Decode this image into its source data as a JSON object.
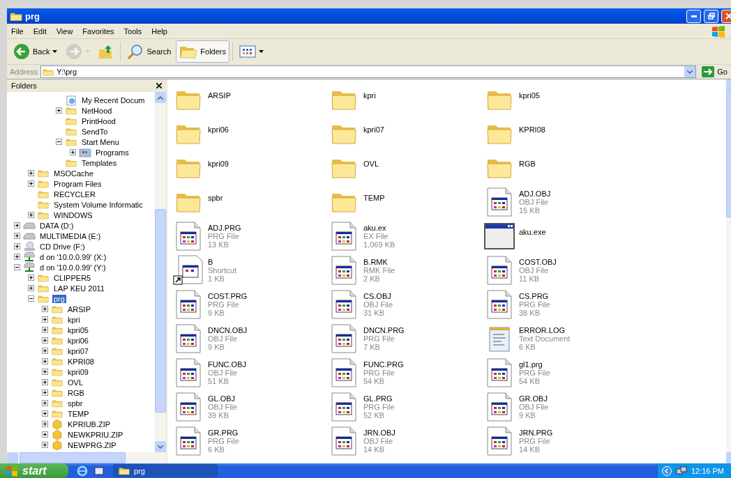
{
  "window": {
    "title": "prg"
  },
  "menu": [
    "File",
    "Edit",
    "View",
    "Favorites",
    "Tools",
    "Help"
  ],
  "toolbar": [
    {
      "kind": "back",
      "label": "Back",
      "caret": true,
      "disabled": false,
      "selected": false
    },
    {
      "kind": "forward",
      "caret": true,
      "disabled": true,
      "selected": false
    },
    {
      "kind": "up",
      "disabled": false,
      "selected": false
    },
    {
      "kind": "search",
      "label": "Search",
      "disabled": false,
      "selected": false
    },
    {
      "kind": "folders",
      "label": "Folders",
      "disabled": false,
      "selected": true
    },
    {
      "kind": "views",
      "caret": true,
      "disabled": false,
      "selected": false
    }
  ],
  "address": {
    "label": "Address",
    "value": "Y:\\prg",
    "go": "Go"
  },
  "folders_pane": {
    "title": "Folders",
    "tree": [
      {
        "children": [
          {
            "children": [
              {
                "children": [
                  {
                    "children": [
                      {
                        "label": "My Recent Docum",
                        "kind": "recent",
                        "selected": false
                      },
                      {
                        "label": "NetHood",
                        "kind": "folder",
                        "expanded": false,
                        "selected": false
                      },
                      {
                        "label": "PrintHood",
                        "kind": "folder",
                        "selected": false
                      },
                      {
                        "label": "SendTo",
                        "kind": "folder",
                        "selected": false
                      },
                      {
                        "label": "Start Menu",
                        "kind": "folder",
                        "expanded": true,
                        "selected": false,
                        "children": [
                          {
                            "label": "Programs",
                            "kind": "programs",
                            "expanded": false,
                            "selected": false
                          }
                        ]
                      },
                      {
                        "label": "Templates",
                        "kind": "folder",
                        "selected": false
                      }
                    ]
                  }
                ]
              },
              {
                "label": "MSOCache",
                "kind": "folder",
                "expanded": false,
                "selected": false
              },
              {
                "label": "Program Files",
                "kind": "folder",
                "expanded": false,
                "selected": false
              },
              {
                "label": "RECYCLER",
                "kind": "folder",
                "selected": false
              },
              {
                "label": "System Volume Informatic",
                "kind": "folder",
                "selected": false
              },
              {
                "label": "WINDOWS",
                "kind": "folder",
                "expanded": false,
                "selected": false
              }
            ]
          },
          {
            "label": "DATA (D:)",
            "kind": "drive",
            "expanded": false,
            "selected": false
          },
          {
            "label": "MULTIMEDIA (E:)",
            "kind": "drive",
            "expanded": false,
            "selected": false
          },
          {
            "label": "CD Drive (F:)",
            "kind": "cdrom",
            "expanded": false,
            "selected": false
          },
          {
            "label": "d on '10.0.0.99' (X:)",
            "kind": "network",
            "expanded": false,
            "selected": false
          },
          {
            "label": "d on '10.0.0.99' (Y:)",
            "kind": "network",
            "expanded": true,
            "selected": false,
            "children": [
              {
                "label": "CLIPPER5",
                "kind": "folder",
                "expanded": false,
                "selected": false
              },
              {
                "label": "LAP KEU 2011",
                "kind": "folder",
                "expanded": false,
                "selected": false
              },
              {
                "label": "prg",
                "kind": "folder",
                "expanded": true,
                "selected": true,
                "children": [
                  {
                    "label": "ARSIP",
                    "kind": "folder",
                    "expanded": false,
                    "selected": false
                  },
                  {
                    "label": "kpri",
                    "kind": "folder",
                    "expanded": false,
                    "selected": false
                  },
                  {
                    "label": "kpri05",
                    "kind": "folder",
                    "expanded": false,
                    "selected": false
                  },
                  {
                    "label": "kpri06",
                    "kind": "folder",
                    "expanded": false,
                    "selected": false
                  },
                  {
                    "label": "kpri07",
                    "kind": "folder",
                    "expanded": false,
                    "selected": false
                  },
                  {
                    "label": "KPRI08",
                    "kind": "folder",
                    "expanded": false,
                    "selected": false
                  },
                  {
                    "label": "kpri09",
                    "kind": "folder",
                    "expanded": false,
                    "selected": false
                  },
                  {
                    "label": "OVL",
                    "kind": "folder",
                    "expanded": false,
                    "selected": false
                  },
                  {
                    "label": "RGB",
                    "kind": "folder",
                    "expanded": false,
                    "selected": false
                  },
                  {
                    "label": "spbr",
                    "kind": "folder",
                    "expanded": false,
                    "selected": false
                  },
                  {
                    "label": "TEMP",
                    "kind": "folder",
                    "expanded": false,
                    "selected": false
                  },
                  {
                    "label": "KPRIUB.ZIP",
                    "kind": "zip",
                    "expanded": false,
                    "selected": false
                  },
                  {
                    "label": "NEWKPRIU.ZIP",
                    "kind": "zip",
                    "expanded": false,
                    "selected": false
                  },
                  {
                    "label": "NEWPRG.ZIP",
                    "kind": "zip",
                    "expanded": false,
                    "selected": false
                  }
                ]
              }
            ]
          }
        ]
      }
    ]
  },
  "files": [
    {
      "name": "ARSIP",
      "kind": "folder"
    },
    {
      "name": "kpri",
      "kind": "folder"
    },
    {
      "name": "kpri05",
      "kind": "folder"
    },
    {
      "name": "kpri06",
      "kind": "folder"
    },
    {
      "name": "kpri07",
      "kind": "folder"
    },
    {
      "name": "KPRI08",
      "kind": "folder"
    },
    {
      "name": "kpri09",
      "kind": "folder"
    },
    {
      "name": "OVL",
      "kind": "folder"
    },
    {
      "name": "RGB",
      "kind": "folder"
    },
    {
      "name": "spbr",
      "kind": "folder"
    },
    {
      "name": "TEMP",
      "kind": "folder"
    },
    {
      "name": "ADJ.OBJ",
      "type": "OBJ File",
      "size": "15 KB",
      "kind": "file"
    },
    {
      "name": "ADJ.PRG",
      "type": "PRG File",
      "size": "13 KB",
      "kind": "file"
    },
    {
      "name": "aku.ex",
      "type": "EX File",
      "size": "1,069 KB",
      "kind": "file"
    },
    {
      "name": "aku.exe",
      "kind": "exe"
    },
    {
      "name": "B",
      "type": "Shortcut",
      "size": "1 KB",
      "kind": "shortcut"
    },
    {
      "name": "B.RMK",
      "type": "RMK File",
      "size": "2 KB",
      "kind": "file"
    },
    {
      "name": "COST.OBJ",
      "type": "OBJ File",
      "size": "11 KB",
      "kind": "file"
    },
    {
      "name": "COST.PRG",
      "type": "PRG File",
      "size": "9 KB",
      "kind": "file"
    },
    {
      "name": "CS.OBJ",
      "type": "OBJ File",
      "size": "31 KB",
      "kind": "file"
    },
    {
      "name": "CS.PRG",
      "type": "PRG File",
      "size": "38 KB",
      "kind": "file"
    },
    {
      "name": "DNCN.OBJ",
      "type": "OBJ File",
      "size": "9 KB",
      "kind": "file"
    },
    {
      "name": "DNCN.PRG",
      "type": "PRG File",
      "size": "7 KB",
      "kind": "file"
    },
    {
      "name": "ERROR.LOG",
      "type": "Text Document",
      "size": "6 KB",
      "kind": "text"
    },
    {
      "name": "FUNC.OBJ",
      "type": "OBJ File",
      "size": "51 KB",
      "kind": "file"
    },
    {
      "name": "FUNC.PRG",
      "type": "PRG File",
      "size": "54 KB",
      "kind": "file"
    },
    {
      "name": "gl1.prg",
      "type": "PRG File",
      "size": "54 KB",
      "kind": "file"
    },
    {
      "name": "GL.OBJ",
      "type": "OBJ File",
      "size": "39 KB",
      "kind": "file"
    },
    {
      "name": "GL.PRG",
      "type": "PRG File",
      "size": "52 KB",
      "kind": "file"
    },
    {
      "name": "GR.OBJ",
      "type": "OBJ File",
      "size": "9 KB",
      "kind": "file"
    },
    {
      "name": "GR.PRG",
      "type": "PRG File",
      "size": "6 KB",
      "kind": "file"
    },
    {
      "name": "JRN.OBJ",
      "type": "OBJ File",
      "size": "14 KB",
      "kind": "file"
    },
    {
      "name": "JRN.PRG",
      "type": "PRG File",
      "size": "14 KB",
      "kind": "file"
    }
  ],
  "taskbar": {
    "start": "start",
    "tasks": [
      {
        "label": "prg",
        "selected": true
      }
    ],
    "clock": "12:16 PM"
  }
}
